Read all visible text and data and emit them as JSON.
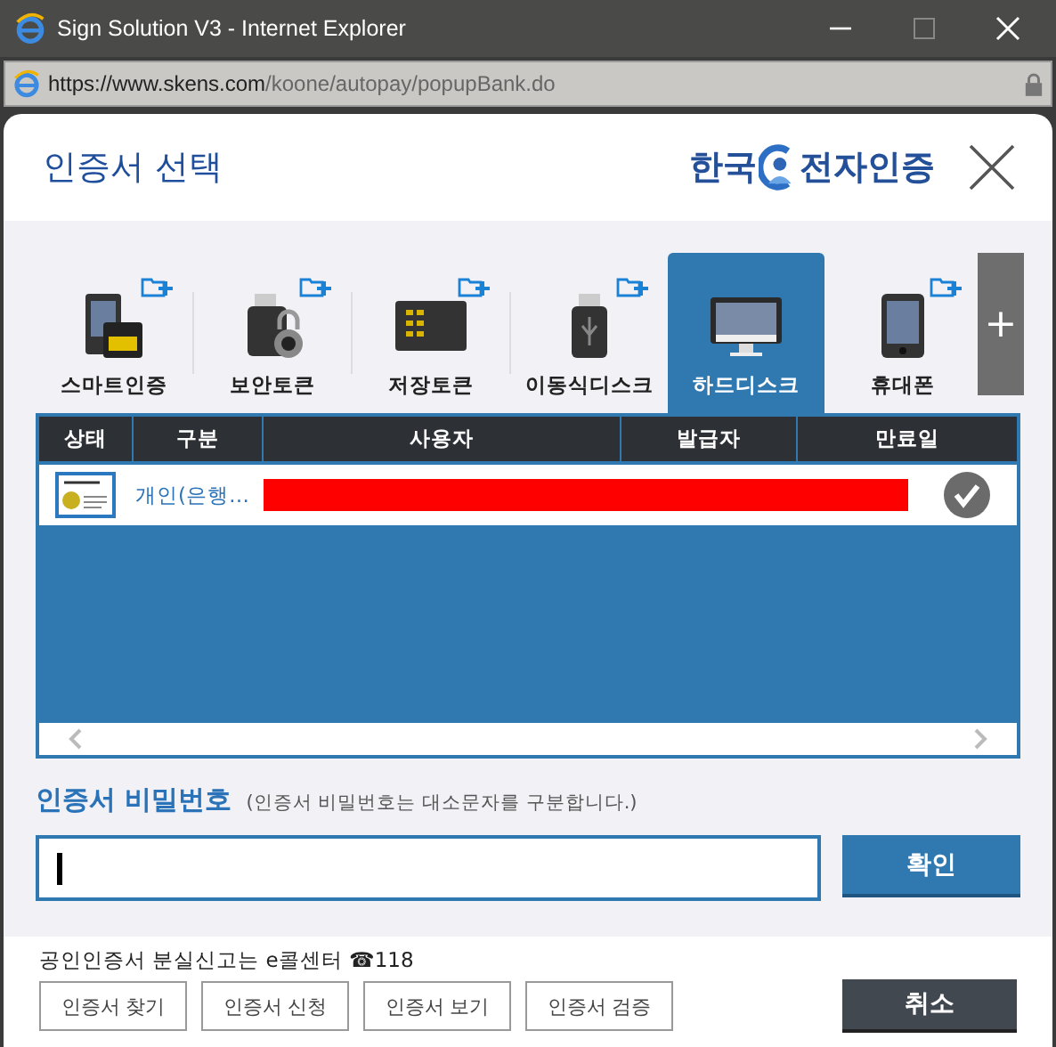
{
  "window": {
    "title": "Sign Solution V3 - Internet Explorer",
    "url_host": "https://www.skens.com",
    "url_path": "/koone/autopay/popupBank.do"
  },
  "dialog": {
    "title": "인증서 선택",
    "logo_left": "한국",
    "logo_right": "전자인증"
  },
  "tabs": [
    {
      "label": "스마트인증",
      "kind": "smart",
      "add_icon": true,
      "selected": false
    },
    {
      "label": "보안토큰",
      "kind": "token",
      "add_icon": true,
      "selected": false
    },
    {
      "label": "저장토큰",
      "kind": "storage",
      "add_icon": true,
      "selected": false
    },
    {
      "label": "이동식디스크",
      "kind": "usb",
      "add_icon": true,
      "selected": false
    },
    {
      "label": "하드디스크",
      "kind": "disk",
      "add_icon": false,
      "selected": true
    },
    {
      "label": "휴대폰",
      "kind": "phone",
      "add_icon": true,
      "selected": false
    }
  ],
  "more_button": "+",
  "table": {
    "columns": [
      "상태",
      "구분",
      "사용자",
      "발급자",
      "만료일"
    ],
    "rows": [
      {
        "type": "개인(은행…",
        "redacted": true,
        "valid": true
      }
    ]
  },
  "password": {
    "label": "인증서 비밀번호",
    "hint": "(인증서 비밀번호는 대소문자를 구분합니다.)",
    "button": "확인"
  },
  "footer": {
    "notice": "공인인증서 분실신고는 e콜센터 ☎118",
    "buttons": [
      "인증서 찾기",
      "인증서 신청",
      "인증서 보기",
      "인증서 검증"
    ],
    "cancel": "취소"
  }
}
